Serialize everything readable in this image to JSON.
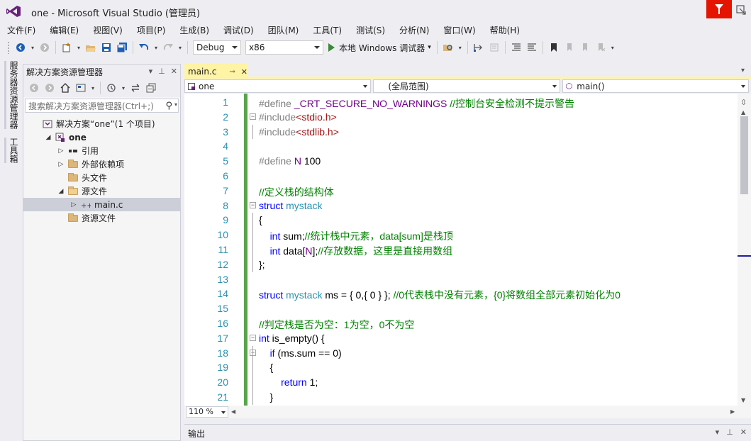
{
  "window": {
    "title": "one - Microsoft Visual Studio (管理员)"
  },
  "menu": [
    "文件(F)",
    "编辑(E)",
    "视图(V)",
    "项目(P)",
    "生成(B)",
    "调试(D)",
    "团队(M)",
    "工具(T)",
    "测试(S)",
    "分析(N)",
    "窗口(W)",
    "帮助(H)"
  ],
  "toolbar": {
    "configuration": "Debug",
    "platform": "x86",
    "start_label": "本地 Windows 调试器"
  },
  "left_strip": {
    "server_explorer": "服务器资源管理器",
    "toolbox": "工具箱"
  },
  "solution_explorer": {
    "title": "解决方案资源管理器",
    "search_placeholder": "搜索解决方案资源管理器(Ctrl+;)",
    "items": [
      {
        "label": "解决方案“one”(1 个项目)",
        "indent": 0,
        "expander": "",
        "icon": "solution"
      },
      {
        "label": "one",
        "indent": 1,
        "expander": "◢",
        "icon": "project",
        "bold": true
      },
      {
        "label": "引用",
        "indent": 2,
        "expander": "▷",
        "icon": "references"
      },
      {
        "label": "外部依赖项",
        "indent": 2,
        "expander": "▷",
        "icon": "external"
      },
      {
        "label": "头文件",
        "indent": 2,
        "expander": "",
        "icon": "folder"
      },
      {
        "label": "源文件",
        "indent": 2,
        "expander": "◢",
        "icon": "folder-open"
      },
      {
        "label": "main.c",
        "indent": 3,
        "expander": "▷",
        "icon": "cfile",
        "selected": true
      },
      {
        "label": "资源文件",
        "indent": 2,
        "expander": "",
        "icon": "folder"
      }
    ]
  },
  "editor": {
    "tab_label": "main.c",
    "nav_project": "one",
    "nav_scope": "(全局范围)",
    "nav_member": "main()",
    "zoom": "110 %",
    "lines": [
      {
        "n": "1",
        "html": "<span class=\"pp\">#define</span> <span class=\"mc\">_CRT_SECURE_NO_WARNINGS</span> <span class=\"cm\">//控制台安全检测不提示警告</span>",
        "fold": "",
        "line": false
      },
      {
        "n": "2",
        "html": "<span class=\"pp\">#include</span><span class=\"st\">&lt;stdio.h&gt;</span>",
        "fold": "−",
        "line": false
      },
      {
        "n": "3",
        "html": "<span class=\"pp\">#include</span><span class=\"st\">&lt;stdlib.h&gt;</span>",
        "fold": "",
        "line": true
      },
      {
        "n": "4",
        "html": "",
        "fold": "",
        "line": false
      },
      {
        "n": "5",
        "html": "<span class=\"pp\">#define</span> <span class=\"mc\">N</span> 100",
        "fold": "",
        "line": false
      },
      {
        "n": "6",
        "html": "",
        "fold": "",
        "line": false
      },
      {
        "n": "7",
        "html": "<span class=\"cm\">//定义栈的结构体</span>",
        "fold": "",
        "line": false
      },
      {
        "n": "8",
        "html": "<span class=\"k\">struct</span> <span class=\"ty\">mystack</span>",
        "fold": "−",
        "line": false
      },
      {
        "n": "9",
        "html": "{",
        "fold": "",
        "line": true
      },
      {
        "n": "10",
        "html": "    <span class=\"k\">int</span> sum;<span class=\"cm\">//统计栈中元素，data[sum]是栈顶</span>",
        "fold": "",
        "line": true
      },
      {
        "n": "11",
        "html": "    <span class=\"k\">int</span> data[<span class=\"mc\">N</span>];<span class=\"cm\">//存放数据，这里是直接用数组</span>",
        "fold": "",
        "line": true
      },
      {
        "n": "12",
        "html": "};",
        "fold": "",
        "line": true
      },
      {
        "n": "13",
        "html": "",
        "fold": "",
        "line": false
      },
      {
        "n": "14",
        "html": "<span class=\"k\">struct</span> <span class=\"ty\">mystack</span> ms = { 0,{ 0 } }; <span class=\"cm\">//0代表栈中没有元素，{0}将数组全部元素初始化为0</span>",
        "fold": "",
        "line": false
      },
      {
        "n": "15",
        "html": "",
        "fold": "",
        "line": false
      },
      {
        "n": "16",
        "html": "<span class=\"cm\">//判定栈是否为空：1为空，0不为空</span>",
        "fold": "",
        "line": false
      },
      {
        "n": "17",
        "html": "<span class=\"k\">int</span> is_empty() {",
        "fold": "−",
        "line": false
      },
      {
        "n": "18",
        "html": "    <span class=\"k\">if</span> (ms.sum == 0)",
        "fold": "−",
        "line": true
      },
      {
        "n": "19",
        "html": "    {",
        "fold": "",
        "line": true
      },
      {
        "n": "20",
        "html": "        <span class=\"k\">return</span> 1;",
        "fold": "",
        "line": true
      },
      {
        "n": "21",
        "html": "    }",
        "fold": "",
        "line": true
      }
    ]
  },
  "output": {
    "title": "输出"
  },
  "colors": {
    "accent": "#e51400",
    "tab_active": "#fff3a6",
    "changes": "#57a64a",
    "keyword": "#0000ff",
    "comment": "#008000",
    "string": "#a31515",
    "line_number": "#2b91af"
  }
}
